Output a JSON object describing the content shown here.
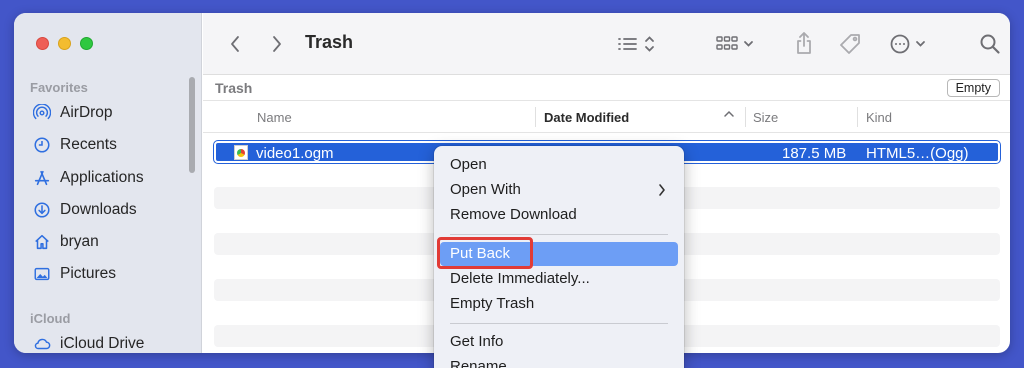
{
  "window": {
    "title": "Trash"
  },
  "sidebar": {
    "favorites_heading": "Favorites",
    "icloud_heading": "iCloud",
    "items": [
      {
        "label": "AirDrop",
        "icon": "airdrop-icon"
      },
      {
        "label": "Recents",
        "icon": "clock-icon"
      },
      {
        "label": "Applications",
        "icon": "applications-icon"
      },
      {
        "label": "Downloads",
        "icon": "download-icon"
      },
      {
        "label": "bryan",
        "icon": "home-icon"
      },
      {
        "label": "Pictures",
        "icon": "pictures-icon"
      }
    ],
    "icloud_items": [
      {
        "label": "iCloud Drive",
        "icon": "cloud-icon"
      }
    ]
  },
  "pathbar": {
    "label": "Trash",
    "empty_button": "Empty"
  },
  "columns": {
    "name": "Name",
    "date_modified": "Date Modified",
    "size": "Size",
    "kind": "Kind"
  },
  "files": [
    {
      "name": "video1.ogm",
      "size": "187.5 MB",
      "kind": "HTML5…(Ogg)",
      "selected": true
    }
  ],
  "context_menu": {
    "items": [
      {
        "label": "Open"
      },
      {
        "label": "Open With"
      },
      {
        "label": "Remove Download"
      },
      {
        "label": "Put Back"
      },
      {
        "label": "Delete Immediately..."
      },
      {
        "label": "Empty Trash"
      },
      {
        "label": "Get Info"
      },
      {
        "label": "Rename"
      }
    ]
  },
  "colors": {
    "accent": "#2461d9",
    "highlight": "#6d9ef5",
    "annotation": "#e13b36",
    "background": "#4356c9"
  }
}
